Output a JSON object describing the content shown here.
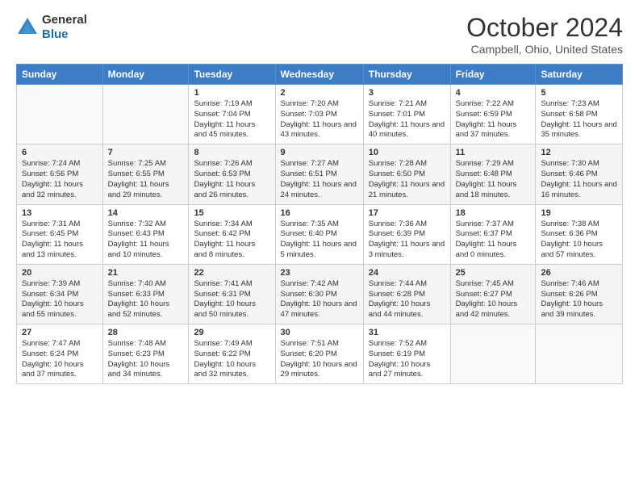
{
  "header": {
    "logo_general": "General",
    "logo_blue": "Blue",
    "title": "October 2024",
    "location": "Campbell, Ohio, United States"
  },
  "weekdays": [
    "Sunday",
    "Monday",
    "Tuesday",
    "Wednesday",
    "Thursday",
    "Friday",
    "Saturday"
  ],
  "weeks": [
    [
      {
        "day": "",
        "sunrise": "",
        "sunset": "",
        "daylight": ""
      },
      {
        "day": "",
        "sunrise": "",
        "sunset": "",
        "daylight": ""
      },
      {
        "day": "1",
        "sunrise": "Sunrise: 7:19 AM",
        "sunset": "Sunset: 7:04 PM",
        "daylight": "Daylight: 11 hours and 45 minutes."
      },
      {
        "day": "2",
        "sunrise": "Sunrise: 7:20 AM",
        "sunset": "Sunset: 7:03 PM",
        "daylight": "Daylight: 11 hours and 43 minutes."
      },
      {
        "day": "3",
        "sunrise": "Sunrise: 7:21 AM",
        "sunset": "Sunset: 7:01 PM",
        "daylight": "Daylight: 11 hours and 40 minutes."
      },
      {
        "day": "4",
        "sunrise": "Sunrise: 7:22 AM",
        "sunset": "Sunset: 6:59 PM",
        "daylight": "Daylight: 11 hours and 37 minutes."
      },
      {
        "day": "5",
        "sunrise": "Sunrise: 7:23 AM",
        "sunset": "Sunset: 6:58 PM",
        "daylight": "Daylight: 11 hours and 35 minutes."
      }
    ],
    [
      {
        "day": "6",
        "sunrise": "Sunrise: 7:24 AM",
        "sunset": "Sunset: 6:56 PM",
        "daylight": "Daylight: 11 hours and 32 minutes."
      },
      {
        "day": "7",
        "sunrise": "Sunrise: 7:25 AM",
        "sunset": "Sunset: 6:55 PM",
        "daylight": "Daylight: 11 hours and 29 minutes."
      },
      {
        "day": "8",
        "sunrise": "Sunrise: 7:26 AM",
        "sunset": "Sunset: 6:53 PM",
        "daylight": "Daylight: 11 hours and 26 minutes."
      },
      {
        "day": "9",
        "sunrise": "Sunrise: 7:27 AM",
        "sunset": "Sunset: 6:51 PM",
        "daylight": "Daylight: 11 hours and 24 minutes."
      },
      {
        "day": "10",
        "sunrise": "Sunrise: 7:28 AM",
        "sunset": "Sunset: 6:50 PM",
        "daylight": "Daylight: 11 hours and 21 minutes."
      },
      {
        "day": "11",
        "sunrise": "Sunrise: 7:29 AM",
        "sunset": "Sunset: 6:48 PM",
        "daylight": "Daylight: 11 hours and 18 minutes."
      },
      {
        "day": "12",
        "sunrise": "Sunrise: 7:30 AM",
        "sunset": "Sunset: 6:46 PM",
        "daylight": "Daylight: 11 hours and 16 minutes."
      }
    ],
    [
      {
        "day": "13",
        "sunrise": "Sunrise: 7:31 AM",
        "sunset": "Sunset: 6:45 PM",
        "daylight": "Daylight: 11 hours and 13 minutes."
      },
      {
        "day": "14",
        "sunrise": "Sunrise: 7:32 AM",
        "sunset": "Sunset: 6:43 PM",
        "daylight": "Daylight: 11 hours and 10 minutes."
      },
      {
        "day": "15",
        "sunrise": "Sunrise: 7:34 AM",
        "sunset": "Sunset: 6:42 PM",
        "daylight": "Daylight: 11 hours and 8 minutes."
      },
      {
        "day": "16",
        "sunrise": "Sunrise: 7:35 AM",
        "sunset": "Sunset: 6:40 PM",
        "daylight": "Daylight: 11 hours and 5 minutes."
      },
      {
        "day": "17",
        "sunrise": "Sunrise: 7:36 AM",
        "sunset": "Sunset: 6:39 PM",
        "daylight": "Daylight: 11 hours and 3 minutes."
      },
      {
        "day": "18",
        "sunrise": "Sunrise: 7:37 AM",
        "sunset": "Sunset: 6:37 PM",
        "daylight": "Daylight: 11 hours and 0 minutes."
      },
      {
        "day": "19",
        "sunrise": "Sunrise: 7:38 AM",
        "sunset": "Sunset: 6:36 PM",
        "daylight": "Daylight: 10 hours and 57 minutes."
      }
    ],
    [
      {
        "day": "20",
        "sunrise": "Sunrise: 7:39 AM",
        "sunset": "Sunset: 6:34 PM",
        "daylight": "Daylight: 10 hours and 55 minutes."
      },
      {
        "day": "21",
        "sunrise": "Sunrise: 7:40 AM",
        "sunset": "Sunset: 6:33 PM",
        "daylight": "Daylight: 10 hours and 52 minutes."
      },
      {
        "day": "22",
        "sunrise": "Sunrise: 7:41 AM",
        "sunset": "Sunset: 6:31 PM",
        "daylight": "Daylight: 10 hours and 50 minutes."
      },
      {
        "day": "23",
        "sunrise": "Sunrise: 7:42 AM",
        "sunset": "Sunset: 6:30 PM",
        "daylight": "Daylight: 10 hours and 47 minutes."
      },
      {
        "day": "24",
        "sunrise": "Sunrise: 7:44 AM",
        "sunset": "Sunset: 6:28 PM",
        "daylight": "Daylight: 10 hours and 44 minutes."
      },
      {
        "day": "25",
        "sunrise": "Sunrise: 7:45 AM",
        "sunset": "Sunset: 6:27 PM",
        "daylight": "Daylight: 10 hours and 42 minutes."
      },
      {
        "day": "26",
        "sunrise": "Sunrise: 7:46 AM",
        "sunset": "Sunset: 6:26 PM",
        "daylight": "Daylight: 10 hours and 39 minutes."
      }
    ],
    [
      {
        "day": "27",
        "sunrise": "Sunrise: 7:47 AM",
        "sunset": "Sunset: 6:24 PM",
        "daylight": "Daylight: 10 hours and 37 minutes."
      },
      {
        "day": "28",
        "sunrise": "Sunrise: 7:48 AM",
        "sunset": "Sunset: 6:23 PM",
        "daylight": "Daylight: 10 hours and 34 minutes."
      },
      {
        "day": "29",
        "sunrise": "Sunrise: 7:49 AM",
        "sunset": "Sunset: 6:22 PM",
        "daylight": "Daylight: 10 hours and 32 minutes."
      },
      {
        "day": "30",
        "sunrise": "Sunrise: 7:51 AM",
        "sunset": "Sunset: 6:20 PM",
        "daylight": "Daylight: 10 hours and 29 minutes."
      },
      {
        "day": "31",
        "sunrise": "Sunrise: 7:52 AM",
        "sunset": "Sunset: 6:19 PM",
        "daylight": "Daylight: 10 hours and 27 minutes."
      },
      {
        "day": "",
        "sunrise": "",
        "sunset": "",
        "daylight": ""
      },
      {
        "day": "",
        "sunrise": "",
        "sunset": "",
        "daylight": ""
      }
    ]
  ]
}
